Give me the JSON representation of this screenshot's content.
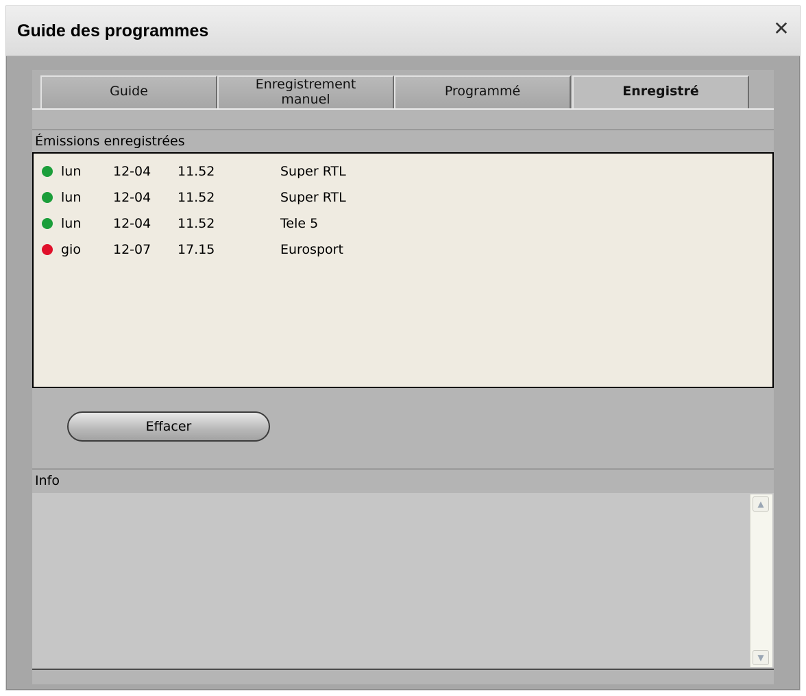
{
  "window": {
    "title": "Guide des programmes"
  },
  "tabs": [
    {
      "label": "Guide"
    },
    {
      "label": "Enregistrement manuel"
    },
    {
      "label": "Programmé"
    },
    {
      "label": "Enregistré"
    }
  ],
  "recordings": {
    "header": "Émissions enregistrées",
    "rows": [
      {
        "status": "green",
        "day": "lun",
        "date": "12-04",
        "time": "11.52",
        "channel": "Super RTL"
      },
      {
        "status": "green",
        "day": "lun",
        "date": "12-04",
        "time": "11.52",
        "channel": "Super RTL"
      },
      {
        "status": "green",
        "day": "lun",
        "date": "12-04",
        "time": "11.52",
        "channel": "Tele 5"
      },
      {
        "status": "red",
        "day": "gio",
        "date": "12-07",
        "time": "17.15",
        "channel": "Eurosport"
      }
    ]
  },
  "actions": {
    "delete_label": "Effacer"
  },
  "info": {
    "header": "Info"
  },
  "colors": {
    "status_green": "#1b9e3a",
    "status_red": "#e0102a",
    "active_tab": "Enregistré"
  },
  "icons": {
    "close": "close-icon",
    "scroll_up": "chevron-up-icon",
    "scroll_down": "chevron-down-icon"
  }
}
